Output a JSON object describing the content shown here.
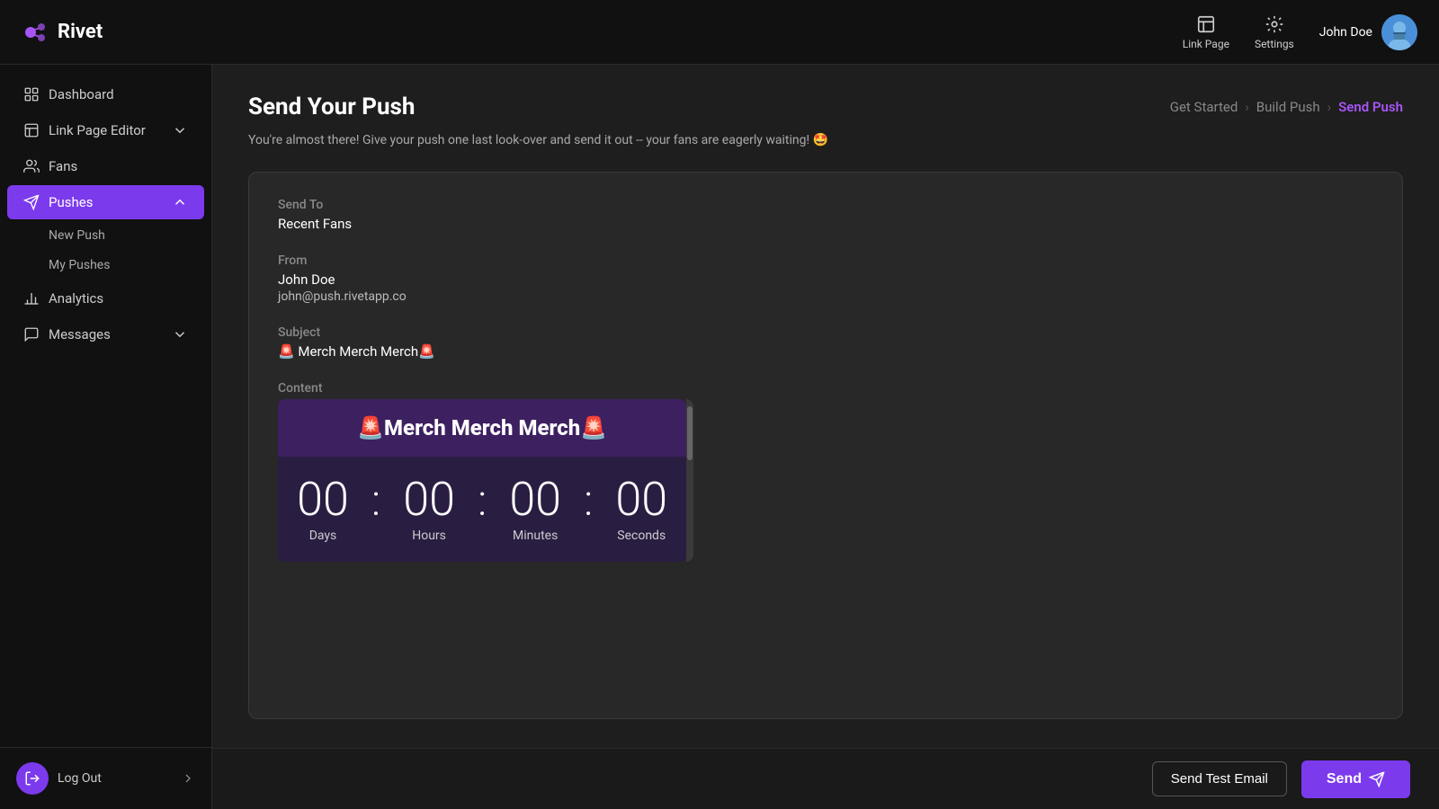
{
  "app": {
    "name": "Rivet"
  },
  "topnav": {
    "link_page_label": "Link Page",
    "settings_label": "Settings",
    "user_name": "John Doe"
  },
  "sidebar": {
    "items": [
      {
        "id": "dashboard",
        "label": "Dashboard"
      },
      {
        "id": "link-page-editor",
        "label": "Link Page Editor",
        "chevron": true
      },
      {
        "id": "fans",
        "label": "Fans"
      },
      {
        "id": "pushes",
        "label": "Pushes",
        "active": true,
        "chevron": true
      },
      {
        "id": "analytics",
        "label": "Analytics"
      },
      {
        "id": "messages",
        "label": "Messages",
        "chevron": true
      }
    ],
    "pushes_sub": [
      {
        "id": "new-push",
        "label": "New Push"
      },
      {
        "id": "my-pushes",
        "label": "My Pushes"
      }
    ],
    "logout_label": "Log Out"
  },
  "page": {
    "title": "Send Your Push",
    "subtitle": "You're almost there! Give your push one last look-over and send it out -- your fans are eagerly waiting! 🤩",
    "breadcrumb": {
      "step1": "Get Started",
      "step2": "Build Push",
      "step3": "Send Push"
    }
  },
  "push_card": {
    "send_to_label": "Send To",
    "send_to_value": "Recent Fans",
    "from_label": "From",
    "from_name": "John Doe",
    "from_email": "john@push.rivetapp.co",
    "subject_label": "Subject",
    "subject_value": "🚨 Merch Merch Merch🚨",
    "content_label": "Content",
    "preview_title": "🚨Merch Merch Merch🚨",
    "countdown": {
      "days": "00",
      "hours": "00",
      "minutes": "00",
      "seconds": "00",
      "days_label": "Days",
      "hours_label": "Hours",
      "minutes_label": "Minutes",
      "seconds_label": "Seconds"
    }
  },
  "bottom_bar": {
    "test_email_label": "Send Test Email",
    "send_label": "Send"
  }
}
